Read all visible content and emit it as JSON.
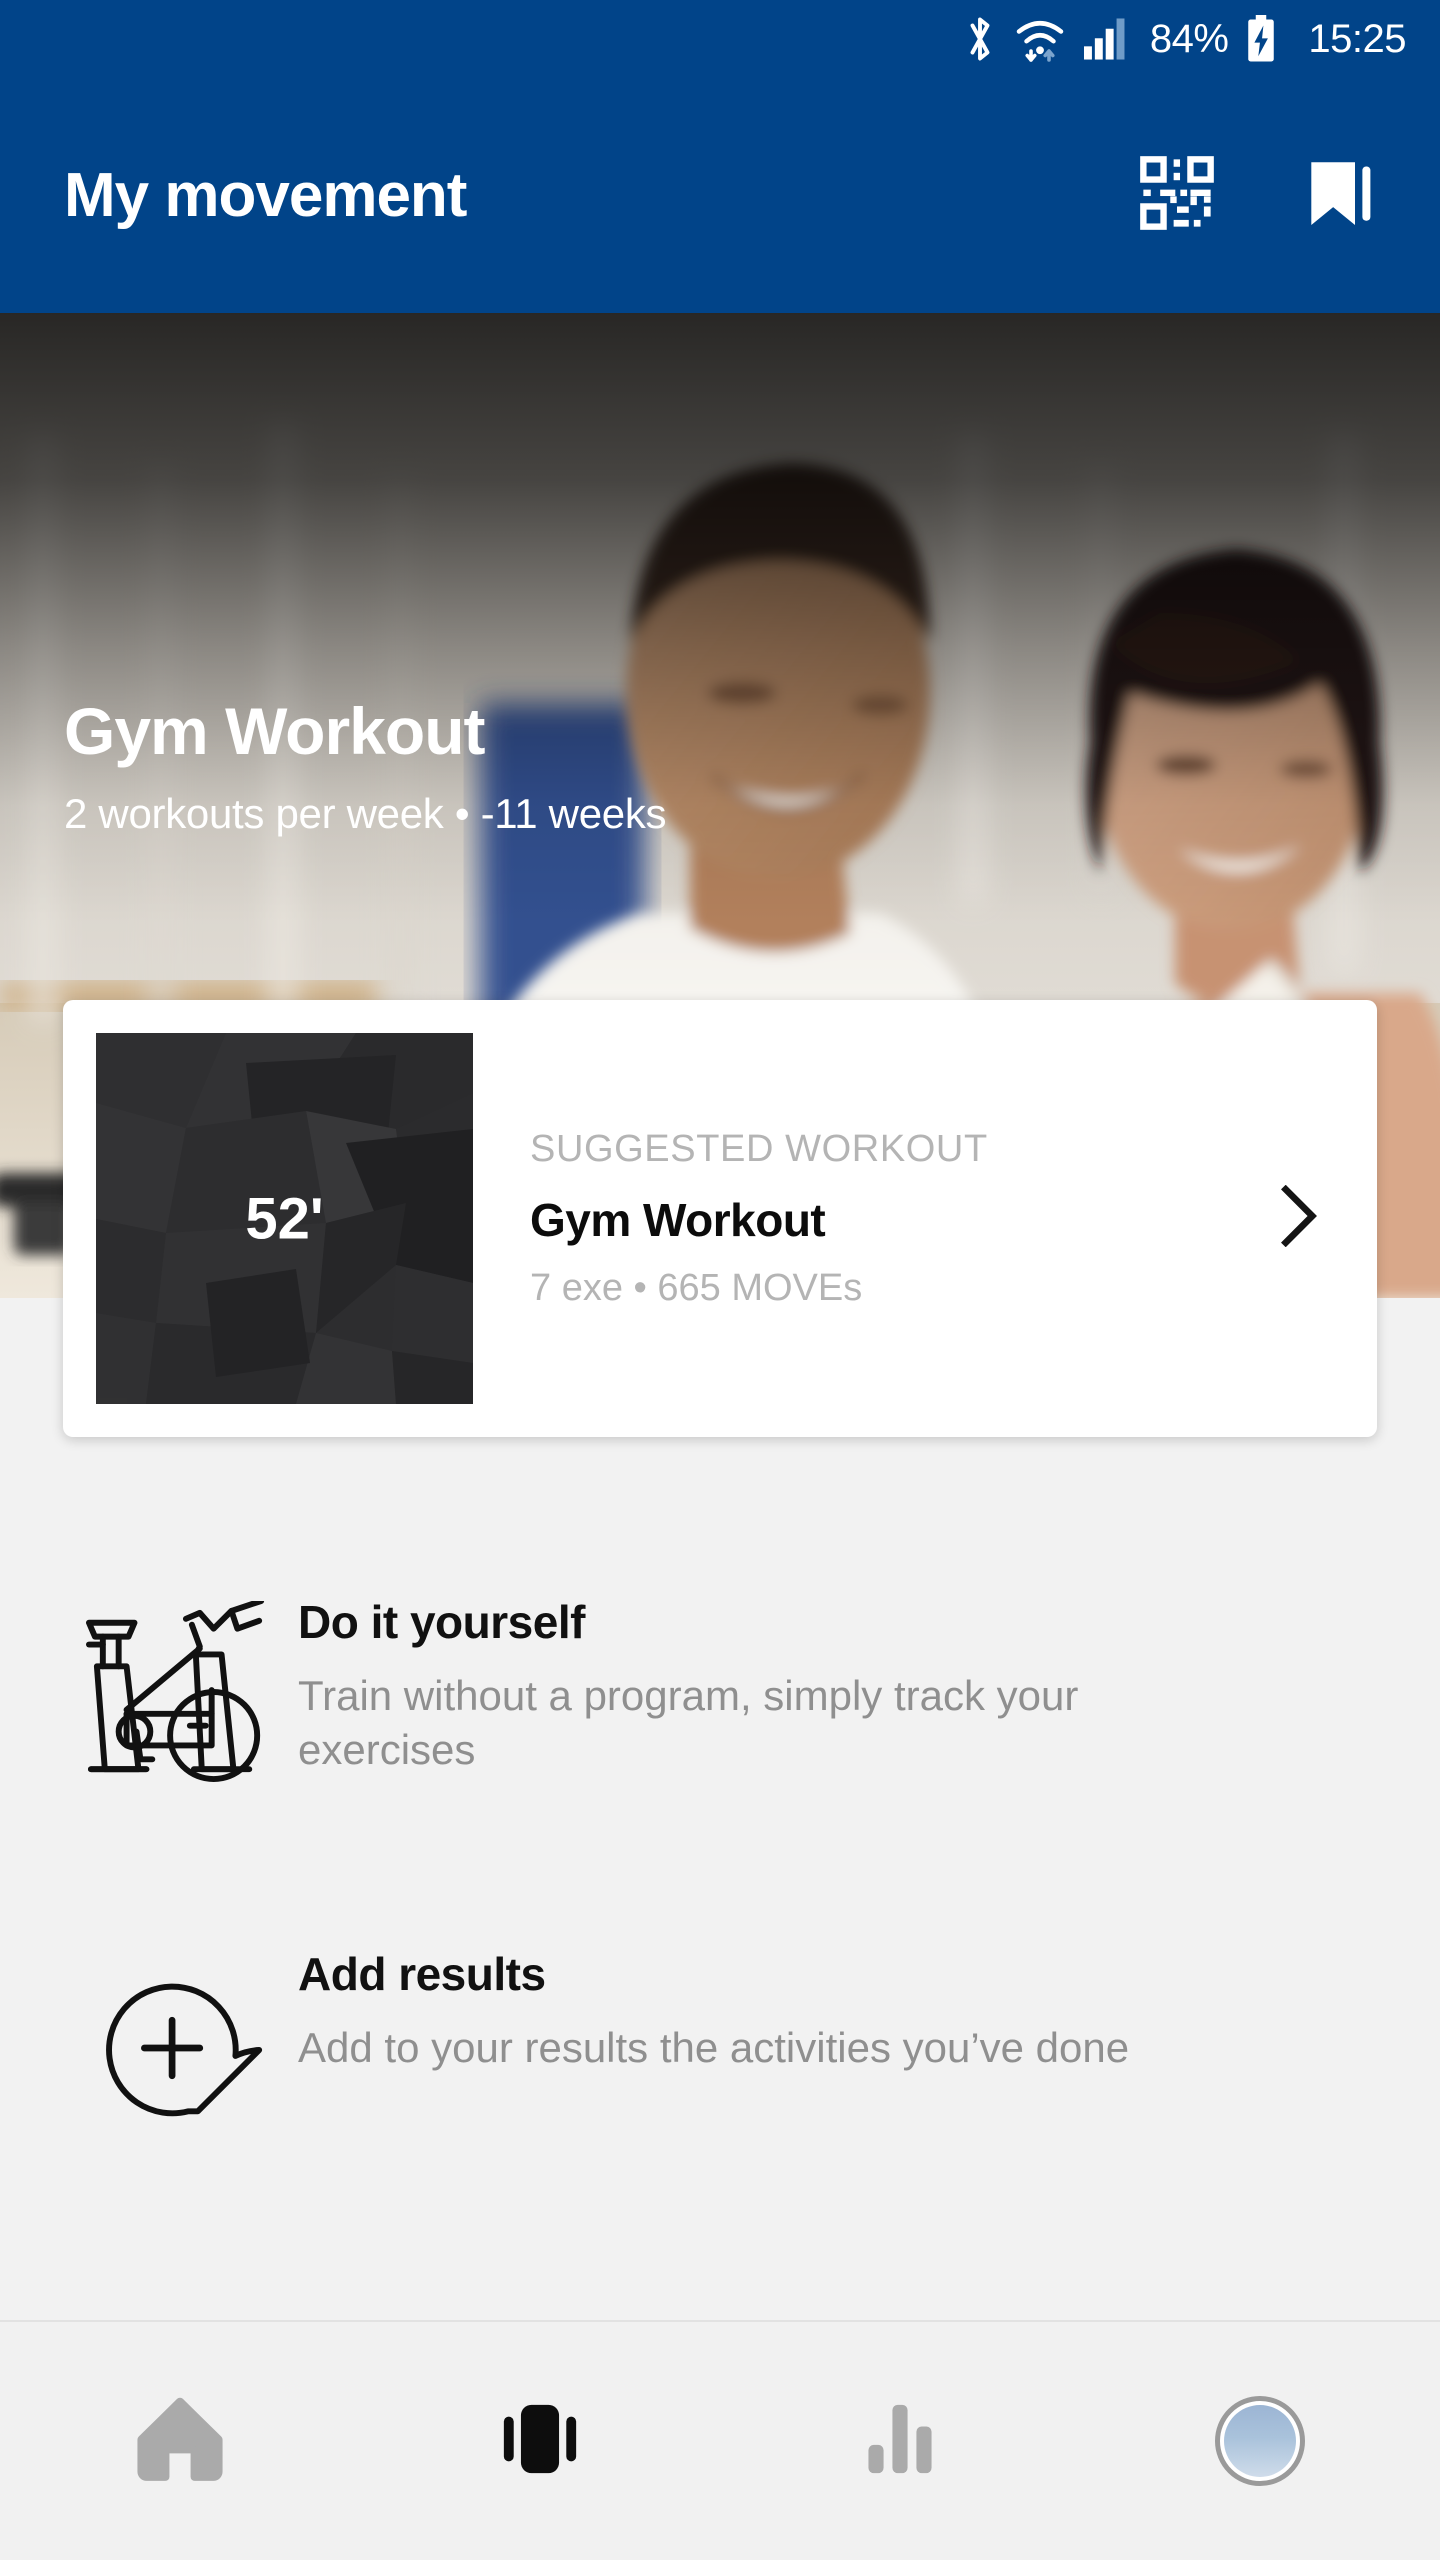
{
  "statusbar": {
    "bluetooth_icon": "bluetooth-icon",
    "wifi_icon": "wifi-icon",
    "signal_icon": "cellular-signal-icon",
    "battery_percent": "84%",
    "battery_icon": "battery-charging-icon",
    "clock": "15:25"
  },
  "appbar": {
    "title": "My movement",
    "qr_icon": "qr-code-scan-icon",
    "bookmark_icon": "bookmark-icon",
    "background_color": "#014489"
  },
  "hero": {
    "title": "Gym Workout",
    "subtitle": "2 workouts per week • -11 weeks"
  },
  "suggested_card": {
    "duration": "52'",
    "eyebrow": "SUGGESTED WORKOUT",
    "title": "Gym Workout",
    "meta": "7 exe • 665 MOVEs",
    "chevron_icon": "chevron-right-icon"
  },
  "options": [
    {
      "icon": "exercise-bike-icon",
      "title": "Do it yourself",
      "description": "Train without a program, simply track your exercises"
    },
    {
      "icon": "add-pin-icon",
      "title": "Add results",
      "description": "Add to your results the activities you’ve done"
    }
  ],
  "bottomnav": {
    "items": [
      {
        "icon": "home-icon",
        "active": false
      },
      {
        "icon": "cards-carousel-icon",
        "active": true
      },
      {
        "icon": "bar-chart-icon",
        "active": false
      },
      {
        "icon": "avatar-icon",
        "active": false
      }
    ],
    "inactive_color": "#aaaaaa",
    "active_color": "#0d0d0d"
  }
}
